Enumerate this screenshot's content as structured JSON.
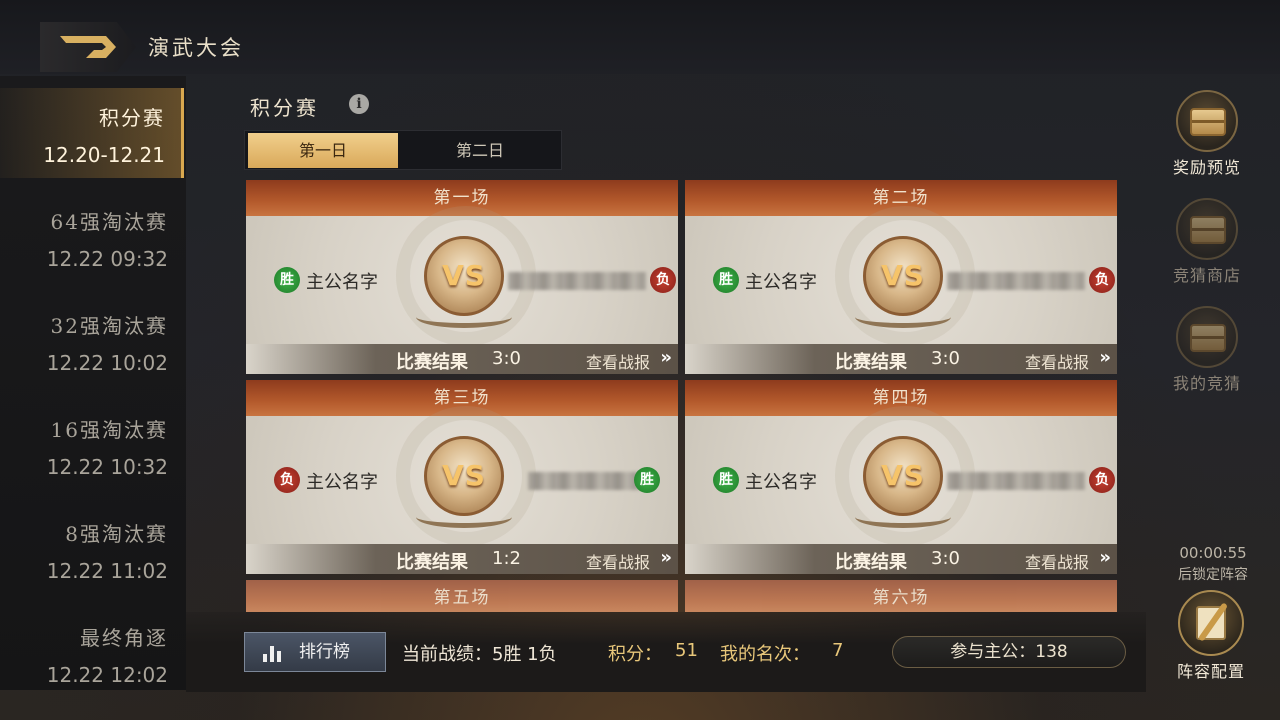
{
  "header": {
    "title": "演武大会"
  },
  "sidebar": {
    "items": [
      {
        "name": "积分赛",
        "time": "12.20-12.21",
        "active": true
      },
      {
        "name": "64强淘汰赛",
        "time": "12.22 09:32",
        "active": false
      },
      {
        "name": "32强淘汰赛",
        "time": "12.22 10:02",
        "active": false
      },
      {
        "name": "16强淘汰赛",
        "time": "12.22 10:32",
        "active": false
      },
      {
        "name": "8强淘汰赛",
        "time": "12.22 11:02",
        "active": false
      },
      {
        "name": "最终角逐",
        "time": "12.22 12:02",
        "active": false
      }
    ]
  },
  "section": {
    "title": "积分赛",
    "info_icon": "i"
  },
  "tabs": [
    {
      "label": "第一日",
      "active": true
    },
    {
      "label": "第二日",
      "active": false
    }
  ],
  "matches": [
    {
      "title": "第一场",
      "player_badge": "胜",
      "player_result": "win",
      "player_name": "主公名字",
      "vs": "VS",
      "opponent_badge": "负",
      "opponent_result": "lose",
      "result_label": "比赛结果",
      "score": "3:0",
      "report_label": "查看战报",
      "report_arrow": "»"
    },
    {
      "title": "第二场",
      "player_badge": "胜",
      "player_result": "win",
      "player_name": "主公名字",
      "vs": "VS",
      "opponent_badge": "负",
      "opponent_result": "lose",
      "result_label": "比赛结果",
      "score": "3:0",
      "report_label": "查看战报",
      "report_arrow": "»"
    },
    {
      "title": "第三场",
      "player_badge": "负",
      "player_result": "lose",
      "player_name": "主公名字",
      "vs": "VS",
      "opponent_badge": "胜",
      "opponent_result": "win",
      "result_label": "比赛结果",
      "score": "1:2",
      "report_label": "查看战报",
      "report_arrow": "»"
    },
    {
      "title": "第四场",
      "player_badge": "胜",
      "player_result": "win",
      "player_name": "主公名字",
      "vs": "VS",
      "opponent_badge": "负",
      "opponent_result": "lose",
      "result_label": "比赛结果",
      "score": "3:0",
      "report_label": "查看战报",
      "report_arrow": "»"
    },
    {
      "title": "第五场"
    },
    {
      "title": "第六场"
    }
  ],
  "bottom": {
    "rank_button": "排行榜",
    "record": "当前战绩：5胜 1负",
    "score_label": "积分：",
    "score_value": "51",
    "rank_label": "我的名次：",
    "rank_value": "7",
    "participants": "参与主公：138"
  },
  "right": {
    "reward_preview": "奖励预览",
    "bet_shop": "竞猜商店",
    "my_bets": "我的竞猜",
    "timer": "00:00:55",
    "timer_sub": "后锁定阵容",
    "lineup": "阵容配置"
  },
  "colors": {
    "accent_gold": "#d9a95a",
    "win_green": "#2f9a3a",
    "lose_red": "#b3352a",
    "card_header": "#a44b24"
  }
}
